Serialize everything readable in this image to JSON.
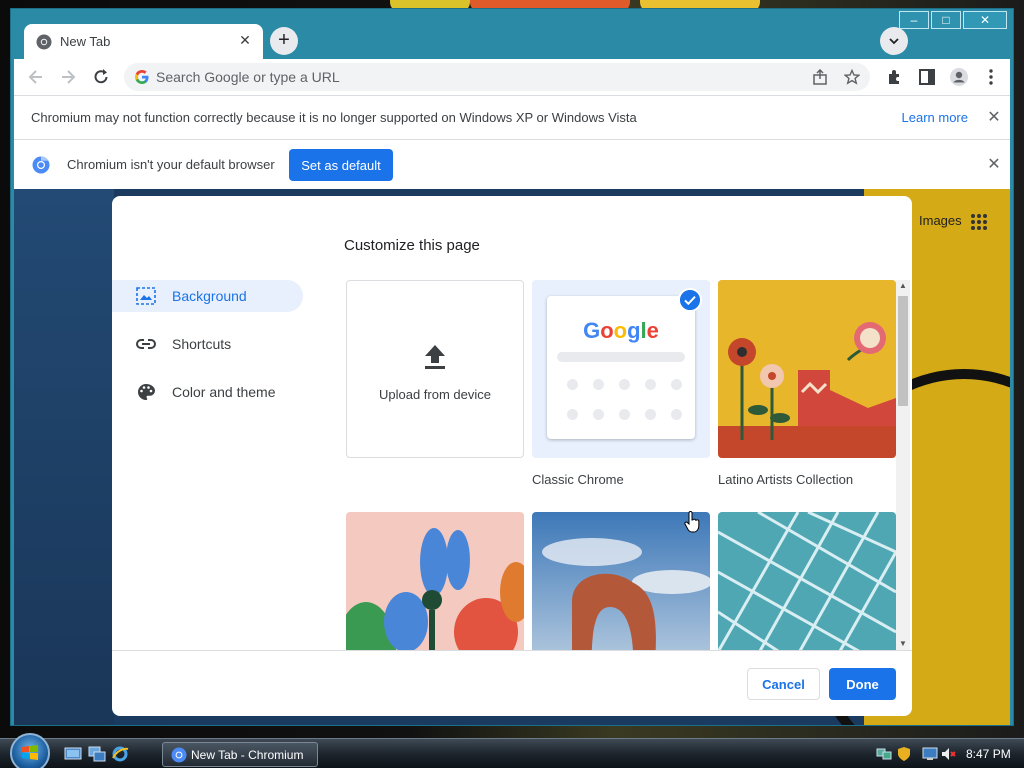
{
  "browser": {
    "tab_title": "New Tab",
    "omnibox_placeholder": "Search Google or type a URL",
    "win_minimize": "–",
    "win_maximize": "□",
    "win_close": "✕",
    "new_tab_symbol": "+",
    "tab_close_symbol": "✕",
    "tab_search_symbol": "⌄"
  },
  "infobar_os": {
    "message": "Chromium may not function correctly because it is no longer supported on Windows XP or Windows Vista",
    "learn_more": "Learn more",
    "close": "✕"
  },
  "infobar_default": {
    "message": "Chromium isn't your default browser",
    "button": "Set as default",
    "close": "✕"
  },
  "newtab_page": {
    "images_link": "Images"
  },
  "customize": {
    "title": "Customize this page",
    "sidebar": [
      {
        "label": "Background",
        "icon": "image-icon",
        "active": true
      },
      {
        "label": "Shortcuts",
        "icon": "link-icon",
        "active": false
      },
      {
        "label": "Color and theme",
        "icon": "palette-icon",
        "active": false
      }
    ],
    "tiles": [
      {
        "label": "Upload from device"
      },
      {
        "label": "Classic Chrome",
        "logo": "Google",
        "selected": true
      },
      {
        "label": "Latino Artists Collection"
      }
    ],
    "cancel": "Cancel",
    "done": "Done"
  },
  "taskbar": {
    "window_button": "New Tab - Chromium",
    "clock": "8:47 PM"
  },
  "colors": {
    "accent": "#1a73e8",
    "title_bar": "#2b8ba7",
    "selected_bg": "#e8f0fe"
  }
}
